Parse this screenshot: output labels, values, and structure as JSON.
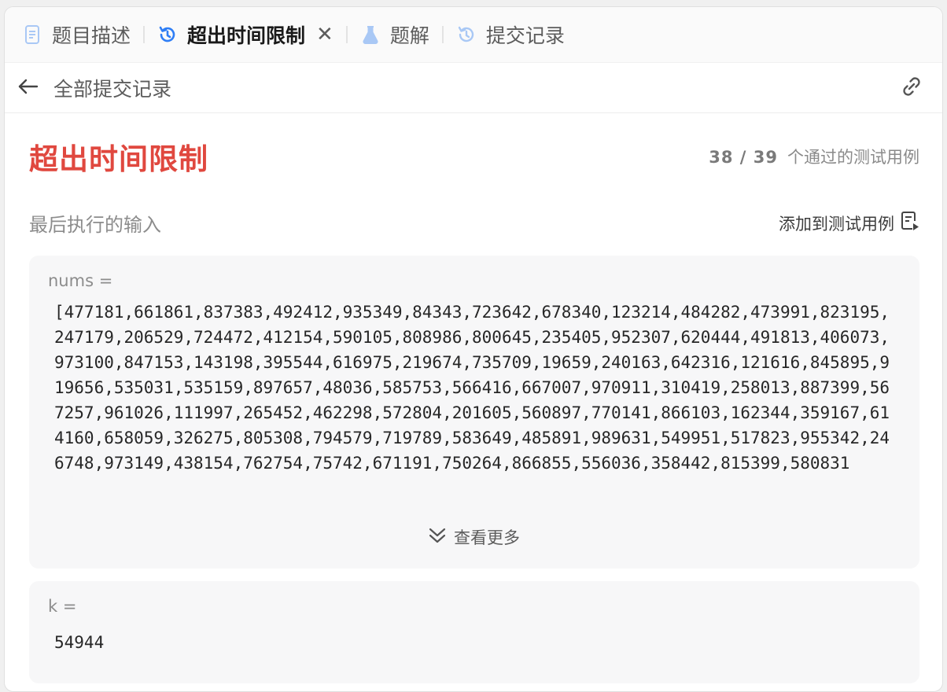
{
  "tabs": [
    {
      "label": "题目描述",
      "icon": "document-icon",
      "active": false
    },
    {
      "label": "超出时间限制",
      "icon": "history-icon",
      "active": true,
      "closable": true
    },
    {
      "label": "题解",
      "icon": "flask-icon",
      "active": false
    },
    {
      "label": "提交记录",
      "icon": "history-icon",
      "active": false
    }
  ],
  "subbar": {
    "back_label": "全部提交记录",
    "link_icon": "link-icon"
  },
  "result": {
    "status": "超出时间限制",
    "status_color": "#e0483f",
    "passed": "38 / 39",
    "passed_suffix": "个通过的测试用例"
  },
  "last_input": {
    "title": "最后执行的输入",
    "add_label": "添加到测试用例",
    "more_label": "查看更多"
  },
  "params": [
    {
      "name": "nums =",
      "value": "[477181,661861,837383,492412,935349,84343,723642,678340,123214,484282,473991,823195,247179,206529,724472,412154,590105,808986,800645,235405,952307,620444,491813,406073,973100,847153,143198,395544,616975,219674,735709,19659,240163,642316,121616,845895,919656,535031,535159,897657,48036,585753,566416,667007,970911,310419,258013,887399,567257,961026,111997,265452,462298,572804,201605,560897,770141,866103,162344,359167,614160,658059,326275,805308,794579,719789,583649,485891,989631,549951,517823,955342,246748,973149,438154,762754,75742,671191,750264,866855,556036,358442,815399,580831"
    },
    {
      "name": "k =",
      "value": "54944"
    }
  ],
  "colors": {
    "accent_blue": "#2f7ef5",
    "icon_blue_light": "#a9c8f5",
    "error_red": "#e0483f"
  }
}
